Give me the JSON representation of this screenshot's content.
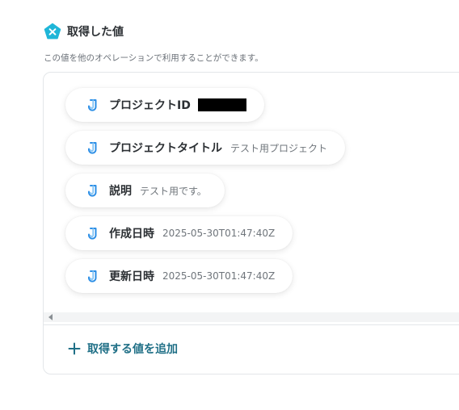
{
  "section": {
    "title": "取得した値",
    "description": "この値を他のオペレーションで利用することができます。",
    "icon": "yoom-x-badge-icon",
    "icon_color": "#1fb6d8"
  },
  "values": [
    {
      "label": "プロジェクトID",
      "value": "",
      "redacted": true
    },
    {
      "label": "プロジェクトタイトル",
      "value": "テスト用プロジェクト"
    },
    {
      "label": "説明",
      "value": "テスト用です。"
    },
    {
      "label": "作成日時",
      "value": "2025-05-30T01:47:40Z"
    },
    {
      "label": "更新日時",
      "value": "2025-05-30T01:47:40Z"
    }
  ],
  "value_icon": "jira-logo-icon",
  "value_icon_color": "#2d8fe6",
  "add_button": {
    "label": "取得する値を追加",
    "icon": "plus-icon",
    "color": "#1f6f86"
  }
}
